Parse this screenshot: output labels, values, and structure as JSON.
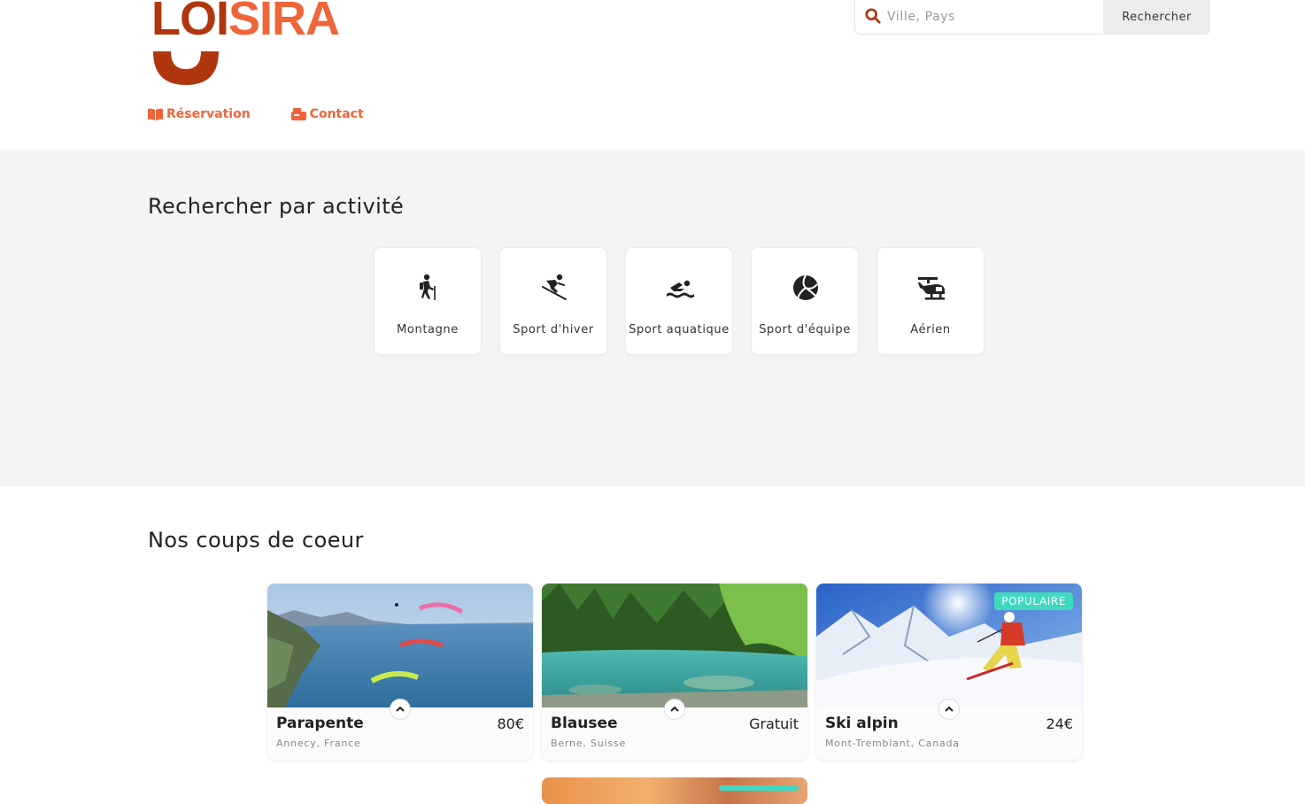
{
  "brand": {
    "logo_text_dark": "LO",
    "logo_text_orange": "SIRA",
    "logo_i": "I",
    "colors": {
      "primary": "#f0643a",
      "dark": "#b0360f",
      "badge": "#3fd9c0",
      "section_bg": "#f4f4f2"
    }
  },
  "search": {
    "placeholder": "Ville, Pays",
    "value": "",
    "button_label": "Rechercher",
    "icon": "search-icon"
  },
  "nav": {
    "items": [
      {
        "label": "Réservation",
        "icon": "book-open-icon"
      },
      {
        "label": "Contact",
        "icon": "mailbox-icon"
      }
    ]
  },
  "activities": {
    "title": "Rechercher par activité",
    "items": [
      {
        "label": "Montagne",
        "icon": "hiking-icon"
      },
      {
        "label": "Sport d'hiver",
        "icon": "skiing-icon"
      },
      {
        "label": "Sport aquatique",
        "icon": "swimmer-icon"
      },
      {
        "label": "Sport d'équipe",
        "icon": "volleyball-icon"
      },
      {
        "label": "Aérien",
        "icon": "helicopter-icon"
      }
    ]
  },
  "favorites": {
    "title": "Nos coups de coeur",
    "items": [
      {
        "name": "Parapente",
        "price": "80€",
        "location": "Annecy, France",
        "badge": ""
      },
      {
        "name": "Blausee",
        "price": "Gratuit",
        "location": "Berne, Suisse",
        "badge": ""
      },
      {
        "name": "Ski alpin",
        "price": "24€",
        "location": "Mont-Tremblant, Canada",
        "badge": "POPULAIRE"
      }
    ]
  }
}
